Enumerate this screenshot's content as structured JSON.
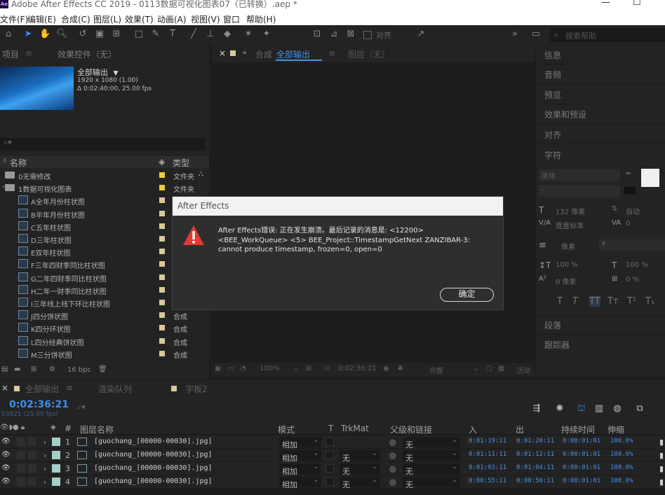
{
  "titlebar": {
    "title": "Adobe After Effects CC 2019 - 0113数据可视化图表07（已转换）.aep *",
    "logo": "Ae"
  },
  "menu": [
    "文件(F)",
    "编辑(E)",
    "合成(C)",
    "图层(L)",
    "效果(T)",
    "动画(A)",
    "视图(V)",
    "窗口",
    "帮助(H)"
  ],
  "toolbar": {
    "align_label": "对齐",
    "search_placeholder": "搜索帮助"
  },
  "project": {
    "tab_project": "项目",
    "tab_effects": "效果控件（无）",
    "comp_name": "全部输出",
    "comp_res": "1920 x 1080 (1.00)",
    "comp_dur": "Δ 0:02:40:00, 25.00 fps",
    "col_name": "名称",
    "col_type": "类型",
    "rows": [
      {
        "name": "0无需修改",
        "type": "文件夹",
        "kind": "folder",
        "color": "#e8d03a"
      },
      {
        "name": "1数据可视化图表",
        "type": "文件夹",
        "kind": "folder",
        "color": "#e8d03a"
      },
      {
        "name": "A全年月份柱状图",
        "type": "",
        "kind": "comp",
        "color": "#d8c89a"
      },
      {
        "name": "B半年月份柱状图",
        "type": "",
        "kind": "comp",
        "color": "#d8c89a"
      },
      {
        "name": "C五年柱状图",
        "type": "",
        "kind": "comp",
        "color": "#d8c89a"
      },
      {
        "name": "D三年柱状图",
        "type": "",
        "kind": "comp",
        "color": "#d8c89a"
      },
      {
        "name": "E双年柱状图",
        "type": "",
        "kind": "comp",
        "color": "#d8c89a"
      },
      {
        "name": "F三年四财季同比柱状图",
        "type": "",
        "kind": "comp",
        "color": "#d8c89a"
      },
      {
        "name": "G二年四财季同比柱状图",
        "type": "",
        "kind": "comp",
        "color": "#d8c89a"
      },
      {
        "name": "H二年一财季同比柱状图",
        "type": "",
        "kind": "comp",
        "color": "#d8c89a"
      },
      {
        "name": "I三年线上线下环比柱状图",
        "type": "",
        "kind": "comp",
        "color": "#d8c89a"
      },
      {
        "name": "J四分饼状图",
        "type": "合成",
        "kind": "comp",
        "color": "#d8c89a"
      },
      {
        "name": "K四分环状图",
        "type": "合成",
        "kind": "comp",
        "color": "#d8c89a"
      },
      {
        "name": "L四分经典饼状图",
        "type": "合成",
        "kind": "comp",
        "color": "#d8c89a"
      },
      {
        "name": "M三分饼状图",
        "type": "合成",
        "kind": "comp",
        "color": "#d8c89a"
      }
    ],
    "bpc": "16 bpc"
  },
  "viewer": {
    "tab_label": "合成",
    "tab_comp": "全部输出",
    "tab_layer": "图层（无）",
    "zoom": "100%",
    "timecode": "0:02:36:21",
    "quality": "完整",
    "camera": "活动"
  },
  "right_panels": [
    "信息",
    "音频",
    "预览",
    "效果和预设",
    "对齐",
    "字符"
  ],
  "right_panels_bottom": [
    "段落",
    "跟踪器"
  ],
  "character": {
    "font": "黑体",
    "size": "132 像素",
    "leading": "自动",
    "tracking_label": "度量标准",
    "tracking": "0",
    "stroke": "像素",
    "vscale": "100 %",
    "hscale": "100 %",
    "baseline": "0 像素",
    "tsume": "0 %"
  },
  "timeline": {
    "tab_comp": "全部输出",
    "tab_render": "渲染队列",
    "tab_other": "字板2",
    "timecode": "0:02:36:21",
    "timecode_sub": "03921 (25.00 fps)",
    "columns": {
      "num": "#",
      "name": "图层名称",
      "mode": "模式",
      "t": "T",
      "trkmat": "TrkMat",
      "parent": "父级和链接",
      "in": "入",
      "out": "出",
      "dur": "持续时间",
      "stretch": "伸缩"
    },
    "layers": [
      {
        "num": "1",
        "name": "[guochang_[00000-00030].jpg]",
        "mode": "相加",
        "trkmat": "",
        "parent": "无",
        "in": "0:01:19:11",
        "out": "0:01:20:11",
        "dur": "0:00:01:01",
        "stretch": "100.0%"
      },
      {
        "num": "2",
        "name": "[guochang_[00000-00030].jpg]",
        "mode": "相加",
        "trkmat": "无",
        "parent": "无",
        "in": "0:01:11:11",
        "out": "0:01:12:11",
        "dur": "0:00:01:01",
        "stretch": "100.0%"
      },
      {
        "num": "3",
        "name": "[guochang_[00000-00030].jpg]",
        "mode": "相加",
        "trkmat": "无",
        "parent": "无",
        "in": "0:01:03:11",
        "out": "0:01:04:11",
        "dur": "0:00:01:01",
        "stretch": "100.0%"
      },
      {
        "num": "4",
        "name": "[guochang_[00000-00030].jpg]",
        "mode": "相加",
        "trkmat": "无",
        "parent": "无",
        "in": "0:00:55:11",
        "out": "0:00:56:11",
        "dur": "0:00:01:01",
        "stretch": "100.0%"
      }
    ]
  },
  "dialog": {
    "title": "After Effects",
    "message": "After Effects错误: 正在发生崩溃。最后记录的消息是: <12200> <BEE_WorkQueue> <5> BEE_Project::TimestampGetNext ZANZIBAR-3: cannot produce timestamp, frozen=0, open=0",
    "ok": "确定"
  }
}
